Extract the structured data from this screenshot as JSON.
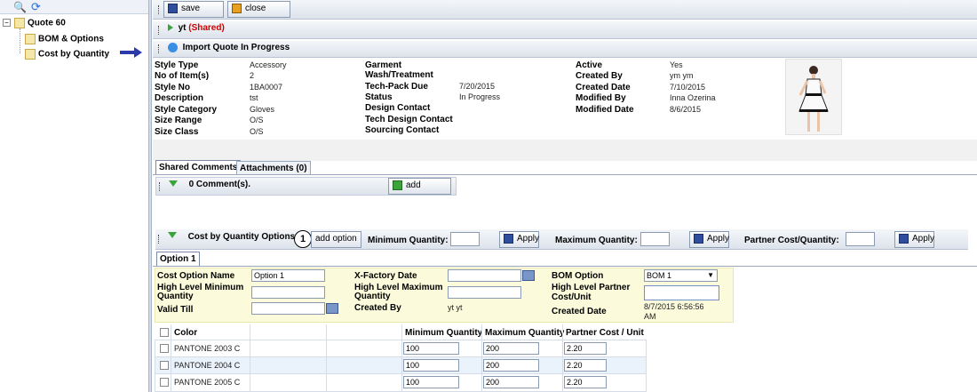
{
  "tree": {
    "root": "Quote 60",
    "children": [
      "BOM & Options",
      "Cost by Quantity"
    ]
  },
  "toolbar": {
    "save": "save",
    "close": "close"
  },
  "shared_bar": {
    "name": "yt",
    "shared": "(Shared)"
  },
  "import_bar": "Import Quote In Progress",
  "details": {
    "col1": [
      {
        "label": "Style Type",
        "value": "Accessory"
      },
      {
        "label": "No of Item(s)",
        "value": "2"
      },
      {
        "label": "Style No",
        "value": "1BA0007"
      },
      {
        "label": "Description",
        "value": "tst"
      },
      {
        "label": "Style Category",
        "value": "Gloves"
      },
      {
        "label": "Size Range",
        "value": "O/S"
      },
      {
        "label": "Size Class",
        "value": "O/S"
      }
    ],
    "col2": [
      {
        "label": "Garment Wash/Treatment",
        "value": ""
      },
      {
        "label": "Tech-Pack Due",
        "value": "7/20/2015"
      },
      {
        "label": "Status",
        "value": "In Progress"
      },
      {
        "label": "Design Contact",
        "value": ""
      },
      {
        "label": "Tech Design Contact",
        "value": ""
      },
      {
        "label": "Sourcing Contact",
        "value": ""
      }
    ],
    "col3": [
      {
        "label": "Active",
        "value": "Yes"
      },
      {
        "label": "Created By",
        "value": "ym ym"
      },
      {
        "label": "Created Date",
        "value": "7/10/2015"
      },
      {
        "label": "Modified By",
        "value": "Inna Ozerina"
      },
      {
        "label": "Modified Date",
        "value": "8/6/2015"
      }
    ]
  },
  "tabs": {
    "shared_comments": "Shared Comments",
    "attachments": "Attachments (0)"
  },
  "comments": {
    "count": "0 Comment(s).",
    "add": "add"
  },
  "cost_bar": {
    "title": "Cost by Quantity Options",
    "callout": "1",
    "add_option": "add option",
    "min_label": "Minimum Quantity:",
    "max_label": "Maximum Quantity:",
    "partner_label": "Partner Cost/Quantity:",
    "apply": "Apply"
  },
  "option_tab": "Option 1",
  "option_form": {
    "cost_option_name_label": "Cost Option Name",
    "cost_option_name_value": "Option 1",
    "hl_min_label": "High Level Minimum Quantity",
    "valid_till_label": "Valid Till",
    "xfactory_label": "X-Factory Date",
    "hl_max_label": "High Level Maximum Quantity",
    "created_by_label": "Created By",
    "created_by_value": "yt yt",
    "bom_option_label": "BOM Option",
    "bom_option_value": "BOM 1",
    "hl_partner_label": "High Level Partner Cost/Unit",
    "created_date_label": "Created Date",
    "created_date_value": "8/7/2015 6:56:56 AM"
  },
  "table": {
    "headers": [
      "Color",
      "Minimum Quantity",
      "Maximum Quantity",
      "Partner Cost / Unit"
    ],
    "rows": [
      {
        "color": "PANTONE 2003 C",
        "min": "100",
        "max": "200",
        "cost": "2.20"
      },
      {
        "color": "PANTONE 2004 C",
        "min": "100",
        "max": "200",
        "cost": "2.20"
      },
      {
        "color": "PANTONE 2005 C",
        "min": "100",
        "max": "200",
        "cost": "2.20"
      }
    ]
  }
}
